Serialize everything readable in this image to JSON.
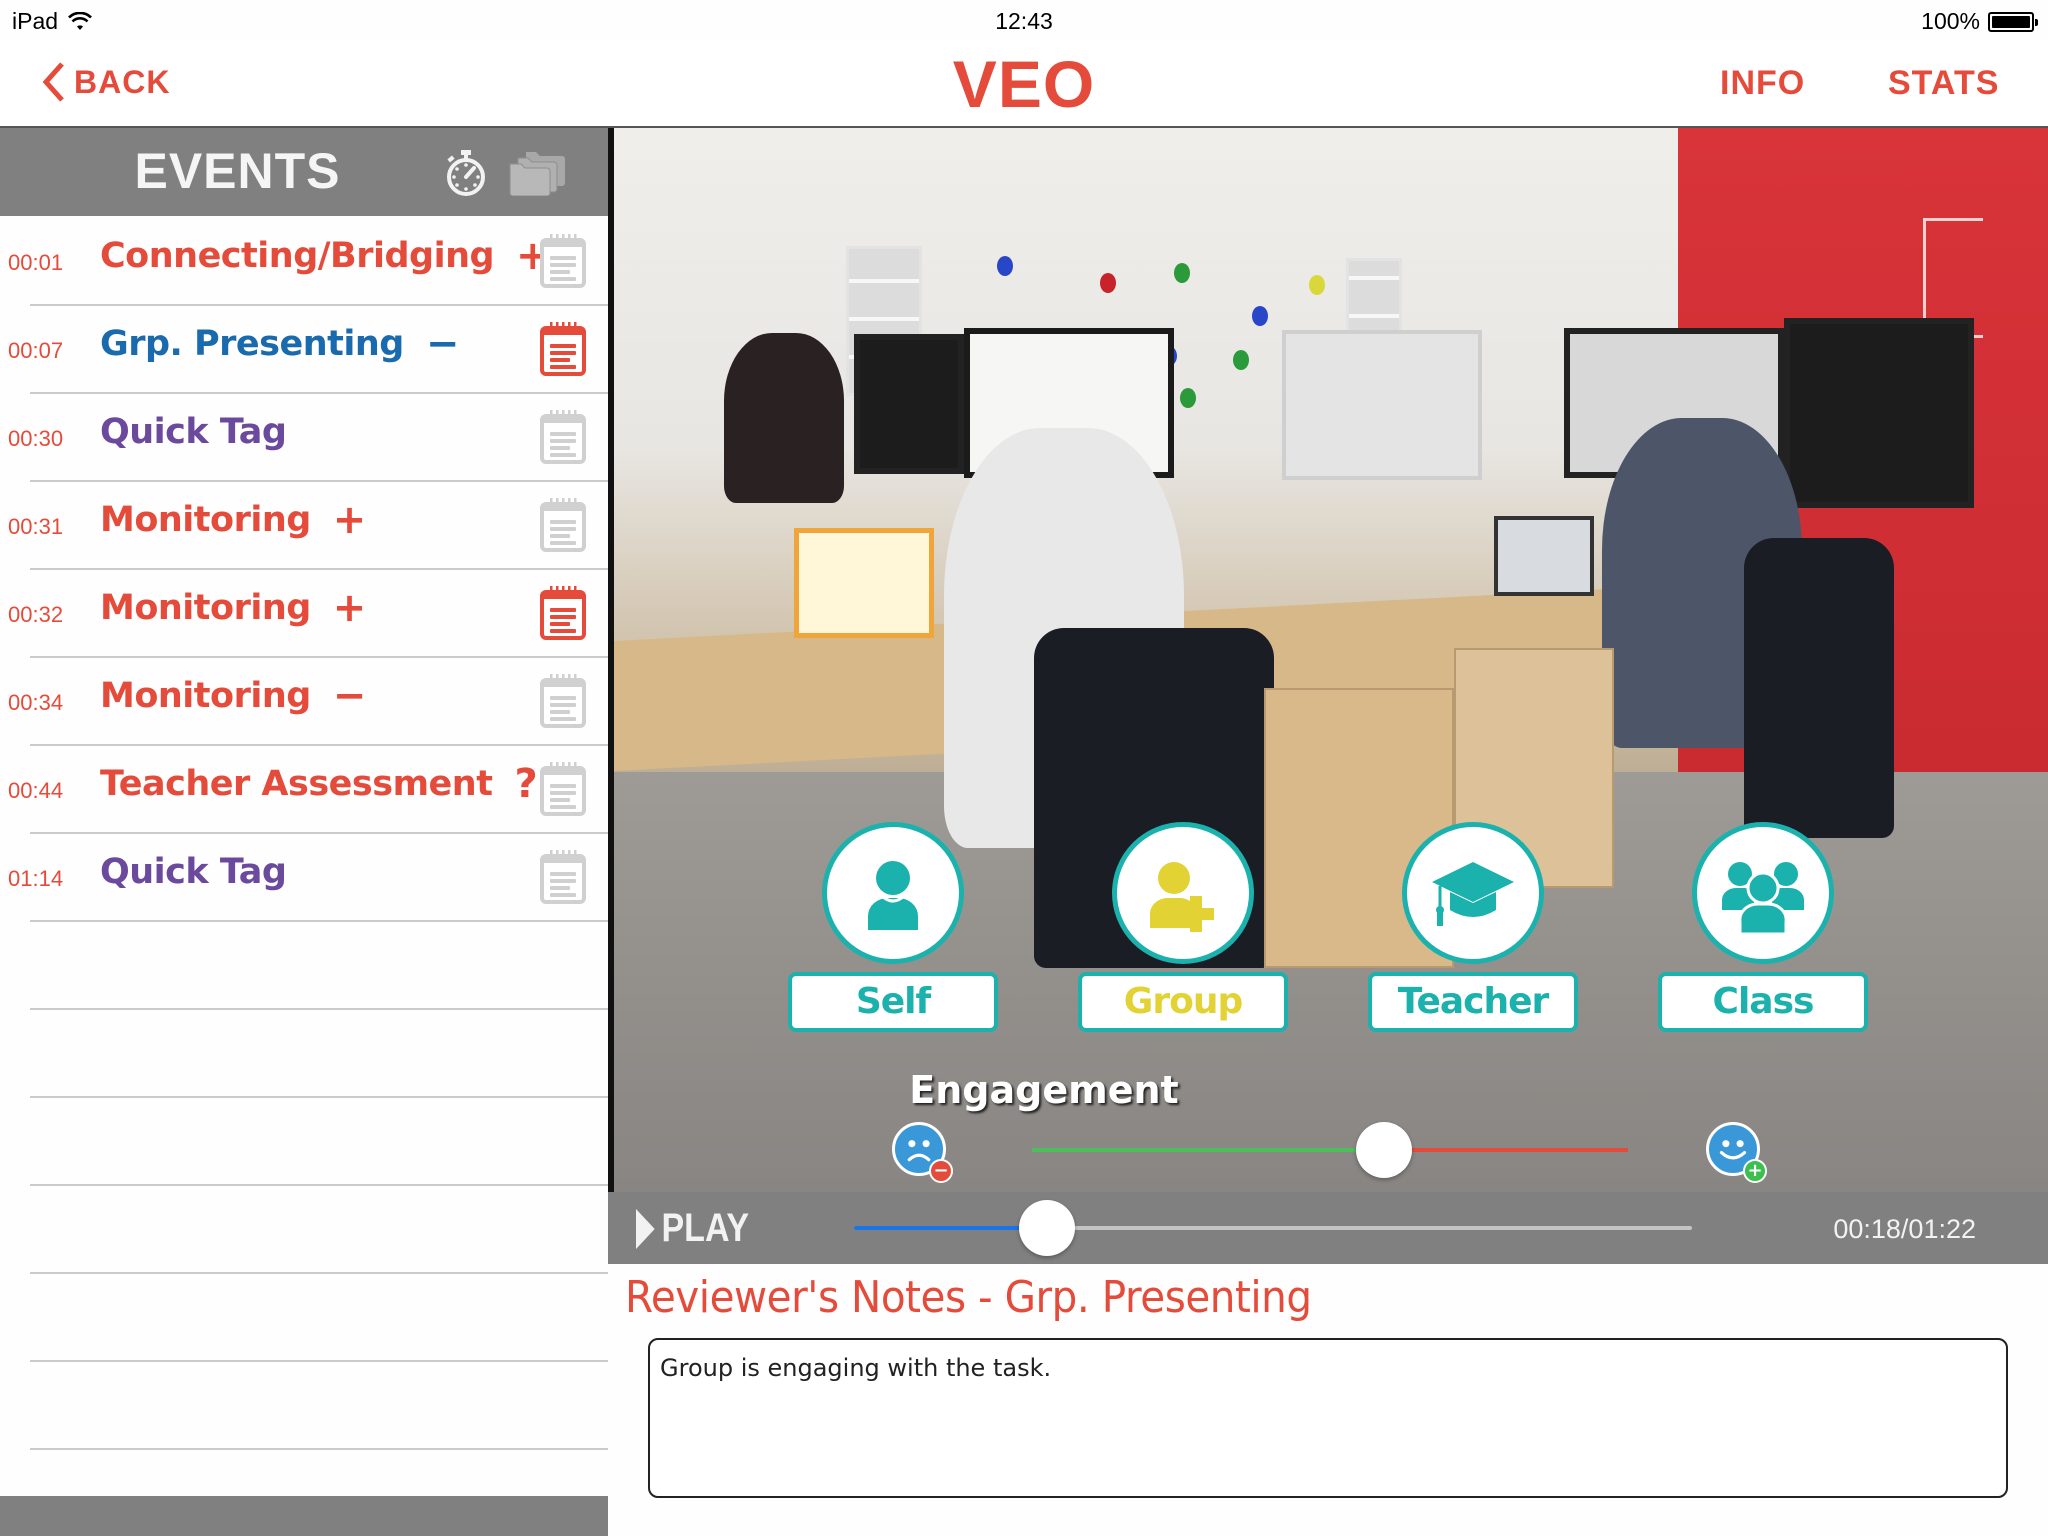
{
  "status_bar": {
    "device": "iPad",
    "time": "12:43",
    "battery": "100%"
  },
  "nav": {
    "back_label": "BACK",
    "title": "VEO",
    "info_label": "INFO",
    "stats_label": "STATS"
  },
  "events": {
    "title": "EVENTS",
    "items": [
      {
        "time": "00:01",
        "label": "Connecting/Bridging",
        "mark": "+",
        "color": "#e54b3a",
        "has_note": false
      },
      {
        "time": "00:07",
        "label": "Grp. Presenting",
        "mark": "−",
        "color": "#1a6aae",
        "has_note": true
      },
      {
        "time": "00:30",
        "label": "Quick Tag",
        "mark": "",
        "color": "#6b4a9e",
        "has_note": false
      },
      {
        "time": "00:31",
        "label": "Monitoring",
        "mark": "+",
        "color": "#e54b3a",
        "has_note": false
      },
      {
        "time": "00:32",
        "label": "Monitoring",
        "mark": "+",
        "color": "#e54b3a",
        "has_note": true
      },
      {
        "time": "00:34",
        "label": "Monitoring",
        "mark": "−",
        "color": "#e54b3a",
        "has_note": false
      },
      {
        "time": "00:44",
        "label": "Teacher Assessment",
        "mark": "?",
        "color": "#e54b3a",
        "has_note": false
      },
      {
        "time": "01:14",
        "label": "Quick Tag",
        "mark": "",
        "color": "#6b4a9e",
        "has_note": false
      }
    ]
  },
  "roles": [
    {
      "label": "Self",
      "icon": "person-icon",
      "color": "#1bb1ad"
    },
    {
      "label": "Group",
      "icon": "add-person-icon",
      "color": "#e2d234"
    },
    {
      "label": "Teacher",
      "icon": "graduation-cap-icon",
      "color": "#1bb1ad"
    },
    {
      "label": "Class",
      "icon": "people-group-icon",
      "color": "#1bb1ad"
    }
  ],
  "engagement": {
    "title": "Engagement",
    "value_fraction": 0.59,
    "low_icon": "sad-face-minus-icon",
    "high_icon": "happy-face-plus-icon"
  },
  "player": {
    "play_label": "PLAY",
    "timecode": "00:18/01:22",
    "progress_fraction": 0.23
  },
  "notes": {
    "title": "Reviewer's Notes - Grp. Presenting",
    "text": "Group is engaging with the task."
  },
  "colors": {
    "accent": "#e54b3a",
    "teal": "#1bb1ad",
    "header_gray": "#808080",
    "note_active": "#e54b3a",
    "note_inactive": "#d0d0d0"
  }
}
